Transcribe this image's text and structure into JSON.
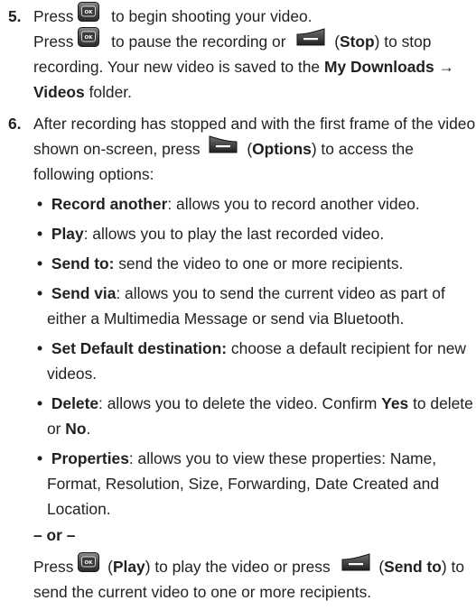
{
  "step5": {
    "num": "5.",
    "l1_a": "Press",
    "l1_b": "to begin shooting your video.",
    "l2_a": "Press",
    "l2_b": "to pause the recording or",
    "l2_c": "(",
    "l2_stop": "Stop",
    "l2_d": ") to stop",
    "l3": "recording. Your new video is saved to the",
    "l3_bold": "My Downloads →",
    "l4_bold": "Videos",
    "l4": "folder."
  },
  "step6": {
    "num": "6.",
    "l1": "After recording has stopped and with the first frame of the video",
    "l2_a": "shown on-screen, press",
    "l2_b": "(",
    "l2_options": "Options",
    "l2_c": ") to access the",
    "l3": "following options:",
    "bullets": [
      {
        "term": "Record another",
        "rest": ": allows you to record another video."
      },
      {
        "term": "Play",
        "rest": ": allows you to play the last recorded video."
      },
      {
        "term": "Send to:",
        "rest": " send the video to one or more recipients."
      },
      {
        "term": "Send via",
        "rest": ": allows you to send the current video as part of",
        "cont": "either a Multimedia Message or send via Bluetooth."
      },
      {
        "term": "Set Default destination:",
        "rest": " choose a default recipient for new",
        "cont": "videos."
      },
      {
        "term": "Delete",
        "rest": ": allows you to delete the video. Confirm ",
        "bold2": "Yes",
        "rest2": " to delete",
        "cont_a": "or ",
        "cont_bold": "No",
        "cont_b": "."
      },
      {
        "term": "Properties",
        "rest": ": allows you to view these properties: Name,",
        "cont": "Format, Resolution, Size, Forwarding, Date Created and",
        "cont2": "Location."
      }
    ],
    "or": "– or –",
    "p1_a": "Press",
    "p1_b": "(",
    "p1_play": "Play",
    "p1_c": ") to play the video or press",
    "p1_d": "(",
    "p1_send": "Send to",
    "p1_e": ") to",
    "p2": "send the current video to one or more recipients."
  },
  "icons": {
    "ok_key_label": "OK"
  }
}
